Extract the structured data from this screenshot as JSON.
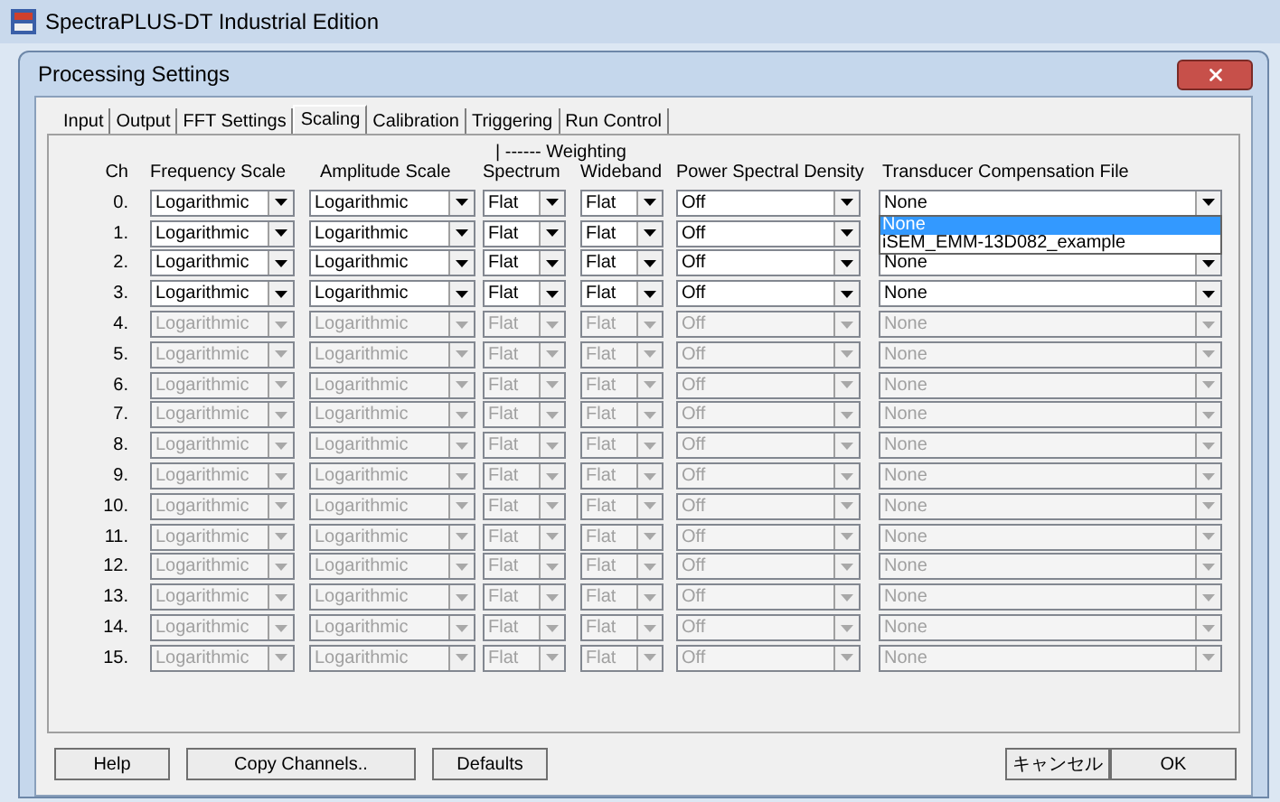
{
  "app_window": {
    "title": "SpectraPLUS-DT Industrial Edition"
  },
  "dialog": {
    "title": "Processing Settings"
  },
  "tabs": [
    {
      "label": "Input",
      "selected": false
    },
    {
      "label": "Output",
      "selected": false
    },
    {
      "label": "FFT Settings",
      "selected": false
    },
    {
      "label": "Scaling",
      "selected": true
    },
    {
      "label": "Calibration",
      "selected": false
    },
    {
      "label": "Triggering",
      "selected": false
    },
    {
      "label": "Run Control",
      "selected": false
    }
  ],
  "weighting_label": "| ------ Weighting",
  "columns": {
    "ch": "Ch",
    "frequency_scale": "Frequency Scale",
    "amplitude_scale": "Amplitude Scale",
    "spectrum": "Spectrum",
    "wideband": "Wideband",
    "psd": "Power Spectral Density",
    "transducer": "Transducer Compensation File"
  },
  "rows": [
    {
      "ch": "0.",
      "frequency_scale": "Logarithmic",
      "amplitude_scale": "Logarithmic",
      "spectrum": "Flat",
      "wideband": "Flat",
      "psd": "Off",
      "transducer": "None",
      "disabled": false,
      "dropdown_options": [
        {
          "label": "None",
          "selected": true
        },
        {
          "label": "iSEM_EMM-13D082_example",
          "selected": false
        }
      ]
    },
    {
      "ch": "1.",
      "frequency_scale": "Logarithmic",
      "amplitude_scale": "Logarithmic",
      "spectrum": "Flat",
      "wideband": "Flat",
      "psd": "Off",
      "disabled": false
    },
    {
      "ch": "2.",
      "frequency_scale": "Logarithmic",
      "amplitude_scale": "Logarithmic",
      "spectrum": "Flat",
      "wideband": "Flat",
      "psd": "Off",
      "transducer": "None",
      "disabled": false
    },
    {
      "ch": "3.",
      "frequency_scale": "Logarithmic",
      "amplitude_scale": "Logarithmic",
      "spectrum": "Flat",
      "wideband": "Flat",
      "psd": "Off",
      "transducer": "None",
      "disabled": false
    },
    {
      "ch": "4.",
      "frequency_scale": "Logarithmic",
      "amplitude_scale": "Logarithmic",
      "spectrum": "Flat",
      "wideband": "Flat",
      "psd": "Off",
      "transducer": "None",
      "disabled": true
    },
    {
      "ch": "5.",
      "frequency_scale": "Logarithmic",
      "amplitude_scale": "Logarithmic",
      "spectrum": "Flat",
      "wideband": "Flat",
      "psd": "Off",
      "transducer": "None",
      "disabled": true
    },
    {
      "ch": "6.",
      "frequency_scale": "Logarithmic",
      "amplitude_scale": "Logarithmic",
      "spectrum": "Flat",
      "wideband": "Flat",
      "psd": "Off",
      "transducer": "None",
      "disabled": true
    },
    {
      "ch": "7.",
      "frequency_scale": "Logarithmic",
      "amplitude_scale": "Logarithmic",
      "spectrum": "Flat",
      "wideband": "Flat",
      "psd": "Off",
      "transducer": "None",
      "disabled": true
    },
    {
      "ch": "8.",
      "frequency_scale": "Logarithmic",
      "amplitude_scale": "Logarithmic",
      "spectrum": "Flat",
      "wideband": "Flat",
      "psd": "Off",
      "transducer": "None",
      "disabled": true
    },
    {
      "ch": "9.",
      "frequency_scale": "Logarithmic",
      "amplitude_scale": "Logarithmic",
      "spectrum": "Flat",
      "wideband": "Flat",
      "psd": "Off",
      "transducer": "None",
      "disabled": true
    },
    {
      "ch": "10.",
      "frequency_scale": "Logarithmic",
      "amplitude_scale": "Logarithmic",
      "spectrum": "Flat",
      "wideband": "Flat",
      "psd": "Off",
      "transducer": "None",
      "disabled": true
    },
    {
      "ch": "11.",
      "frequency_scale": "Logarithmic",
      "amplitude_scale": "Logarithmic",
      "spectrum": "Flat",
      "wideband": "Flat",
      "psd": "Off",
      "transducer": "None",
      "disabled": true
    },
    {
      "ch": "12.",
      "frequency_scale": "Logarithmic",
      "amplitude_scale": "Logarithmic",
      "spectrum": "Flat",
      "wideband": "Flat",
      "psd": "Off",
      "transducer": "None",
      "disabled": true
    },
    {
      "ch": "13.",
      "frequency_scale": "Logarithmic",
      "amplitude_scale": "Logarithmic",
      "spectrum": "Flat",
      "wideband": "Flat",
      "psd": "Off",
      "transducer": "None",
      "disabled": true
    },
    {
      "ch": "14.",
      "frequency_scale": "Logarithmic",
      "amplitude_scale": "Logarithmic",
      "spectrum": "Flat",
      "wideband": "Flat",
      "psd": "Off",
      "transducer": "None",
      "disabled": true
    },
    {
      "ch": "15.",
      "frequency_scale": "Logarithmic",
      "amplitude_scale": "Logarithmic",
      "spectrum": "Flat",
      "wideband": "Flat",
      "psd": "Off",
      "transducer": "None",
      "disabled": true
    }
  ],
  "left_buttons": [
    "Help",
    "Copy Channels..",
    "Defaults"
  ],
  "right_buttons": [
    "キャンセル",
    "OK"
  ]
}
